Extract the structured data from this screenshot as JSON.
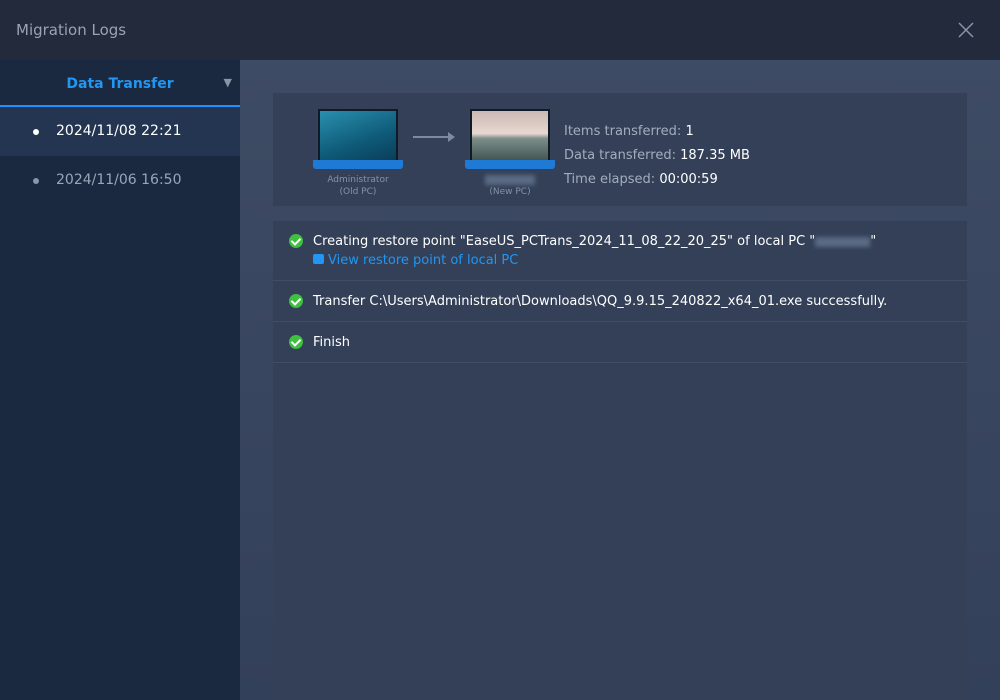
{
  "window": {
    "title": "Migration Logs"
  },
  "sidebar": {
    "header": "Data Transfer",
    "items": [
      {
        "label": "2024/11/08 22:21",
        "selected": true
      },
      {
        "label": "2024/11/06 16:50",
        "selected": false
      }
    ]
  },
  "summary": {
    "old_pc": {
      "name": "Administrator",
      "role": "(Old PC)"
    },
    "new_pc": {
      "role": "(New PC)"
    },
    "items_label": "Items transferred:",
    "items_value": "1",
    "data_label": "Data transferred:",
    "data_value": "187.35 MB",
    "time_label": "Time elapsed:",
    "time_value": "00:00:59"
  },
  "logs": [
    {
      "text": "Creating restore point \"EaseUS_PCTrans_2024_11_08_22_20_25\" of local PC \"",
      "text_end": "\"",
      "link": "View restore point of local PC"
    },
    {
      "text": "Transfer C:\\Users\\Administrator\\Downloads\\QQ_9.9.15_240822_x64_01.exe successfully."
    },
    {
      "text": "Finish"
    }
  ],
  "colors": {
    "accent": "#2196f3",
    "success": "#3fbf3f"
  }
}
